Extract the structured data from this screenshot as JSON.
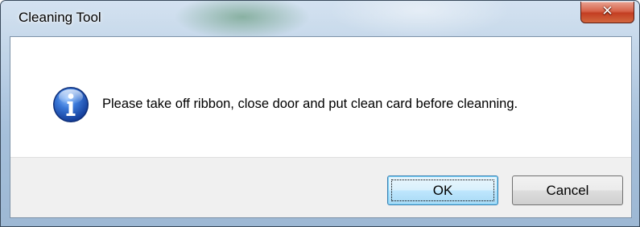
{
  "window": {
    "title": "Cleaning Tool",
    "close_icon": "close-icon"
  },
  "dialog": {
    "icon": "info-icon",
    "message": "Please take off ribbon, close door and put clean card before cleanning."
  },
  "buttons": {
    "ok_label": "OK",
    "cancel_label": "Cancel"
  },
  "colors": {
    "close_button": "#c94a2c",
    "info_icon": "#2c64c8",
    "default_button_border": "#3c7fb1"
  }
}
